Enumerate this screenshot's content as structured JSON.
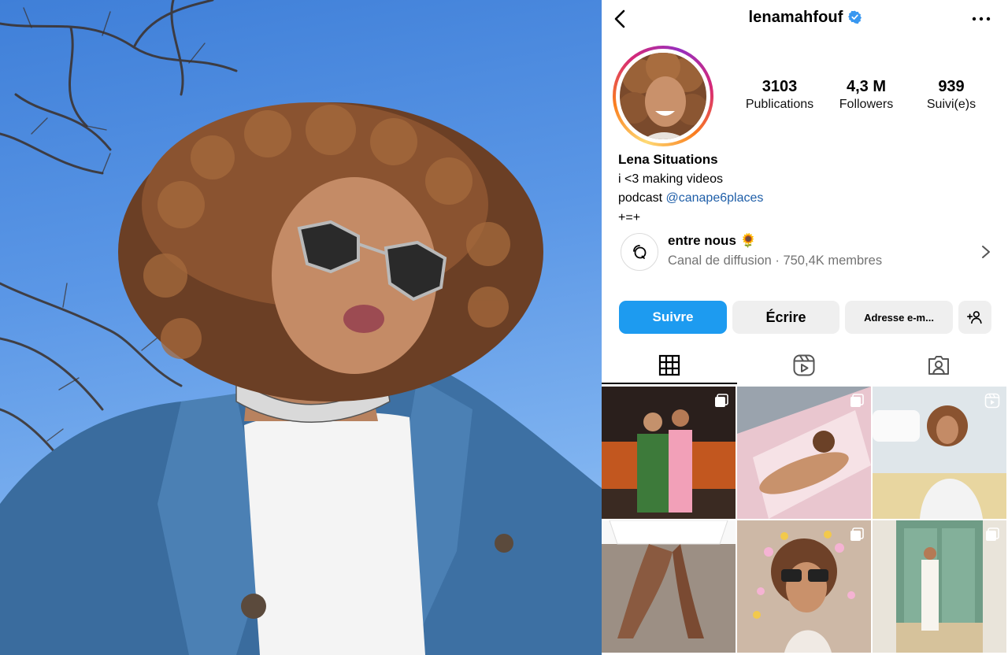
{
  "profile": {
    "username": "lenamahfouf",
    "verified": true,
    "display_name": "Lena Situations",
    "bio_line_1": "i <3 making videos",
    "bio_line_2_prefix": "podcast ",
    "bio_line_2_mention": "@canape6places",
    "bio_line_3": "+=+"
  },
  "stats": [
    {
      "value": "3103",
      "label": "Publications"
    },
    {
      "value": "4,3 M",
      "label": "Followers"
    },
    {
      "value": "939",
      "label": "Suivi(e)s"
    }
  ],
  "channel": {
    "title": "entre nous 🌻",
    "subtitle": "Canal de diffusion · 750,4K membres"
  },
  "buttons": {
    "follow": "Suivre",
    "write": "Écrire",
    "email": "Adresse e-m..."
  },
  "tabs": [
    {
      "icon": "grid-icon",
      "active": true
    },
    {
      "icon": "reels-icon",
      "active": false
    },
    {
      "icon": "tagged-icon",
      "active": false
    }
  ],
  "posts": [
    {
      "type": "carousel"
    },
    {
      "type": "carousel"
    },
    {
      "type": "reel"
    },
    {
      "type": "photo"
    },
    {
      "type": "carousel"
    },
    {
      "type": "carousel"
    }
  ],
  "colors": {
    "accent": "#1d9bf0",
    "link": "#1e5ea8",
    "secondary_text": "#737373",
    "button_bg": "#efefef"
  }
}
